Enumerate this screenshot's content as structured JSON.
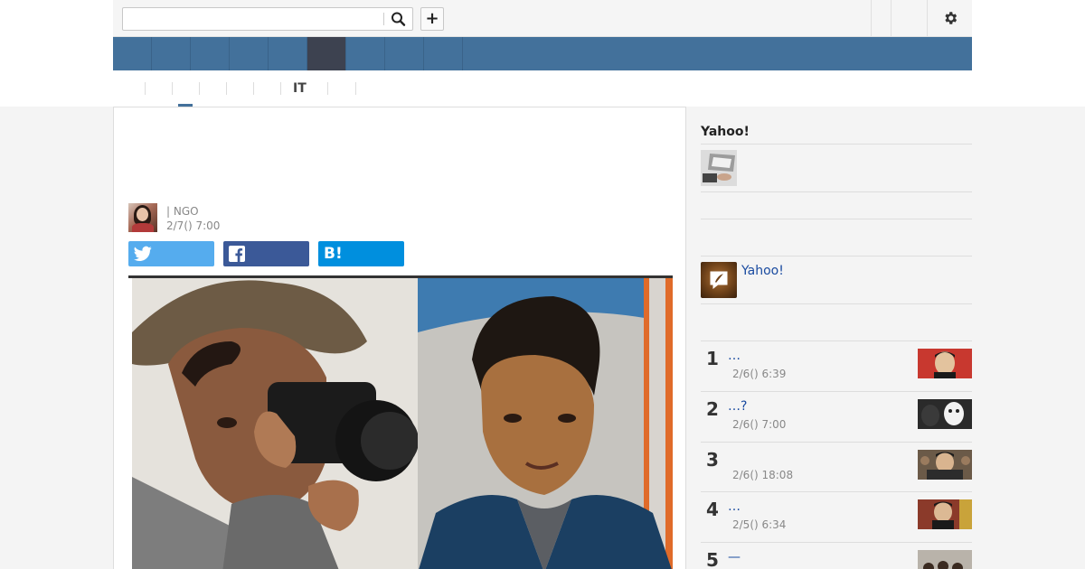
{
  "search": {
    "placeholder": "",
    "value": ""
  },
  "topbar": {
    "plus_label": "+",
    "icons": [
      "search-icon",
      "plus-icon",
      "gear-icon"
    ]
  },
  "nav": {
    "items": [
      "",
      "",
      "",
      "",
      "",
      "",
      "",
      "",
      ""
    ],
    "active_index": 5,
    "colors": {
      "bar": "#43719b",
      "active": "#3d4250"
    }
  },
  "subtabs": {
    "items": [
      "",
      "",
      "",
      "",
      "",
      "IT",
      "",
      ""
    ],
    "active_index": 1
  },
  "article": {
    "title": "",
    "byline": "| NGO",
    "date": "2/7() 7:00",
    "share": {
      "twitter_label": "",
      "facebook_label": "",
      "hatena_label": "B!"
    }
  },
  "sidebar": {
    "title": "Yahoo!",
    "promo_text": "Yahoo!",
    "ranking": [
      {
        "rank": "1",
        "title": "…",
        "date": "2/6() 6:39"
      },
      {
        "rank": "2",
        "title": "…?",
        "date": "2/6() 7:00"
      },
      {
        "rank": "3",
        "title": "",
        "date": "2/6() 18:08"
      },
      {
        "rank": "4",
        "title": "…",
        "date": "2/5() 6:34"
      },
      {
        "rank": "5",
        "title": "—",
        "date": ""
      }
    ]
  }
}
